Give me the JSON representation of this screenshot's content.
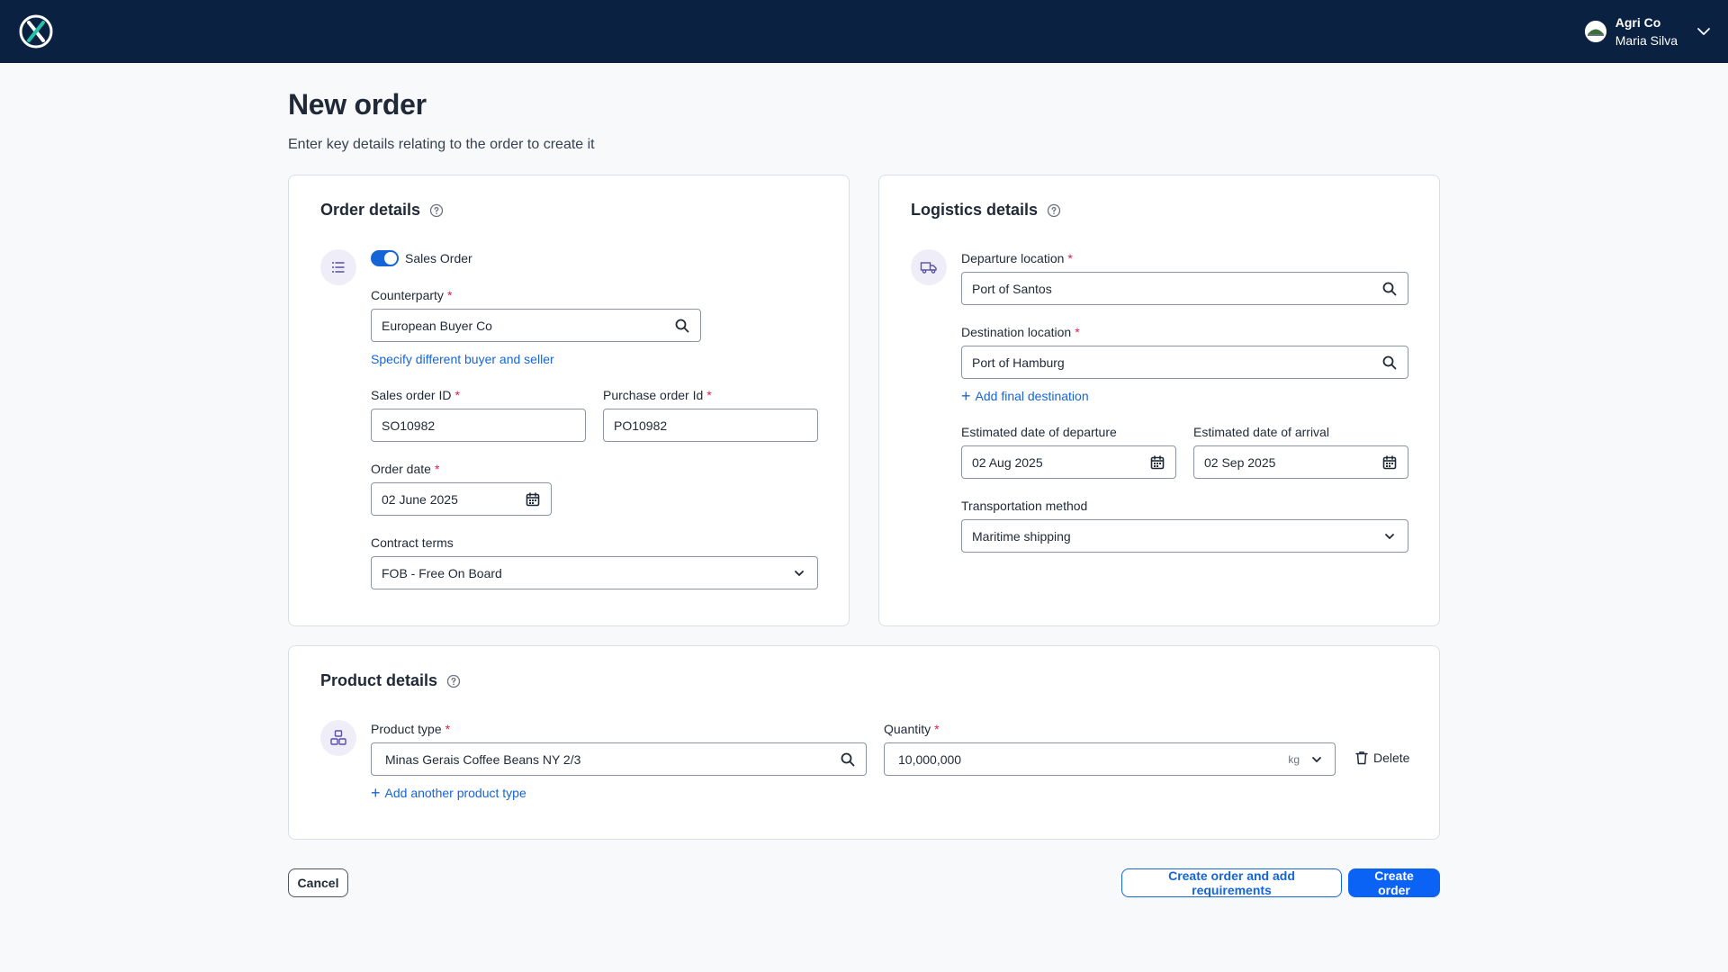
{
  "header": {
    "company": "Agri Co",
    "user_name": "Maria Silva"
  },
  "page": {
    "title": "New order",
    "subtitle": "Enter key details relating to the order to create it"
  },
  "order_details": {
    "title": "Order details",
    "sales_order_toggle_label": "Sales Order",
    "counterparty_label": "Counterparty",
    "counterparty_value": "European Buyer Co",
    "specify_link": "Specify different buyer and seller",
    "sales_order_id_label": "Sales order ID",
    "sales_order_id_value": "SO10982",
    "purchase_order_id_label": "Purchase order Id",
    "purchase_order_id_value": "PO10982",
    "order_date_label": "Order date",
    "order_date_value": "02 June 2025",
    "contract_terms_label": "Contract terms",
    "contract_terms_value": "FOB - Free On Board"
  },
  "logistics_details": {
    "title": "Logistics details",
    "departure_label": "Departure location",
    "departure_value": "Port of Santos",
    "destination_label": "Destination location",
    "destination_value": "Port of Hamburg",
    "add_final_destination": "Add final destination",
    "edd_label": "Estimated date of departure",
    "edd_value": "02 Aug 2025",
    "eda_label": "Estimated date of arrival",
    "eda_value": "02 Sep 2025",
    "transport_label": "Transportation method",
    "transport_value": "Maritime shipping"
  },
  "product_details": {
    "title": "Product details",
    "product_type_label": "Product type",
    "product_type_value": "Minas Gerais Coffee Beans NY 2/3",
    "quantity_label": "Quantity",
    "quantity_value": "10,000,000",
    "quantity_unit": "kg",
    "delete_label": "Delete",
    "add_product_link": "Add another product type"
  },
  "actions": {
    "cancel": "Cancel",
    "create_and_add": "Create order and add requirements",
    "create": "Create order"
  },
  "colors": {
    "header_bg": "#0a2142",
    "primary": "#0b63f6",
    "link": "#1565d8",
    "required": "#e11d48"
  }
}
